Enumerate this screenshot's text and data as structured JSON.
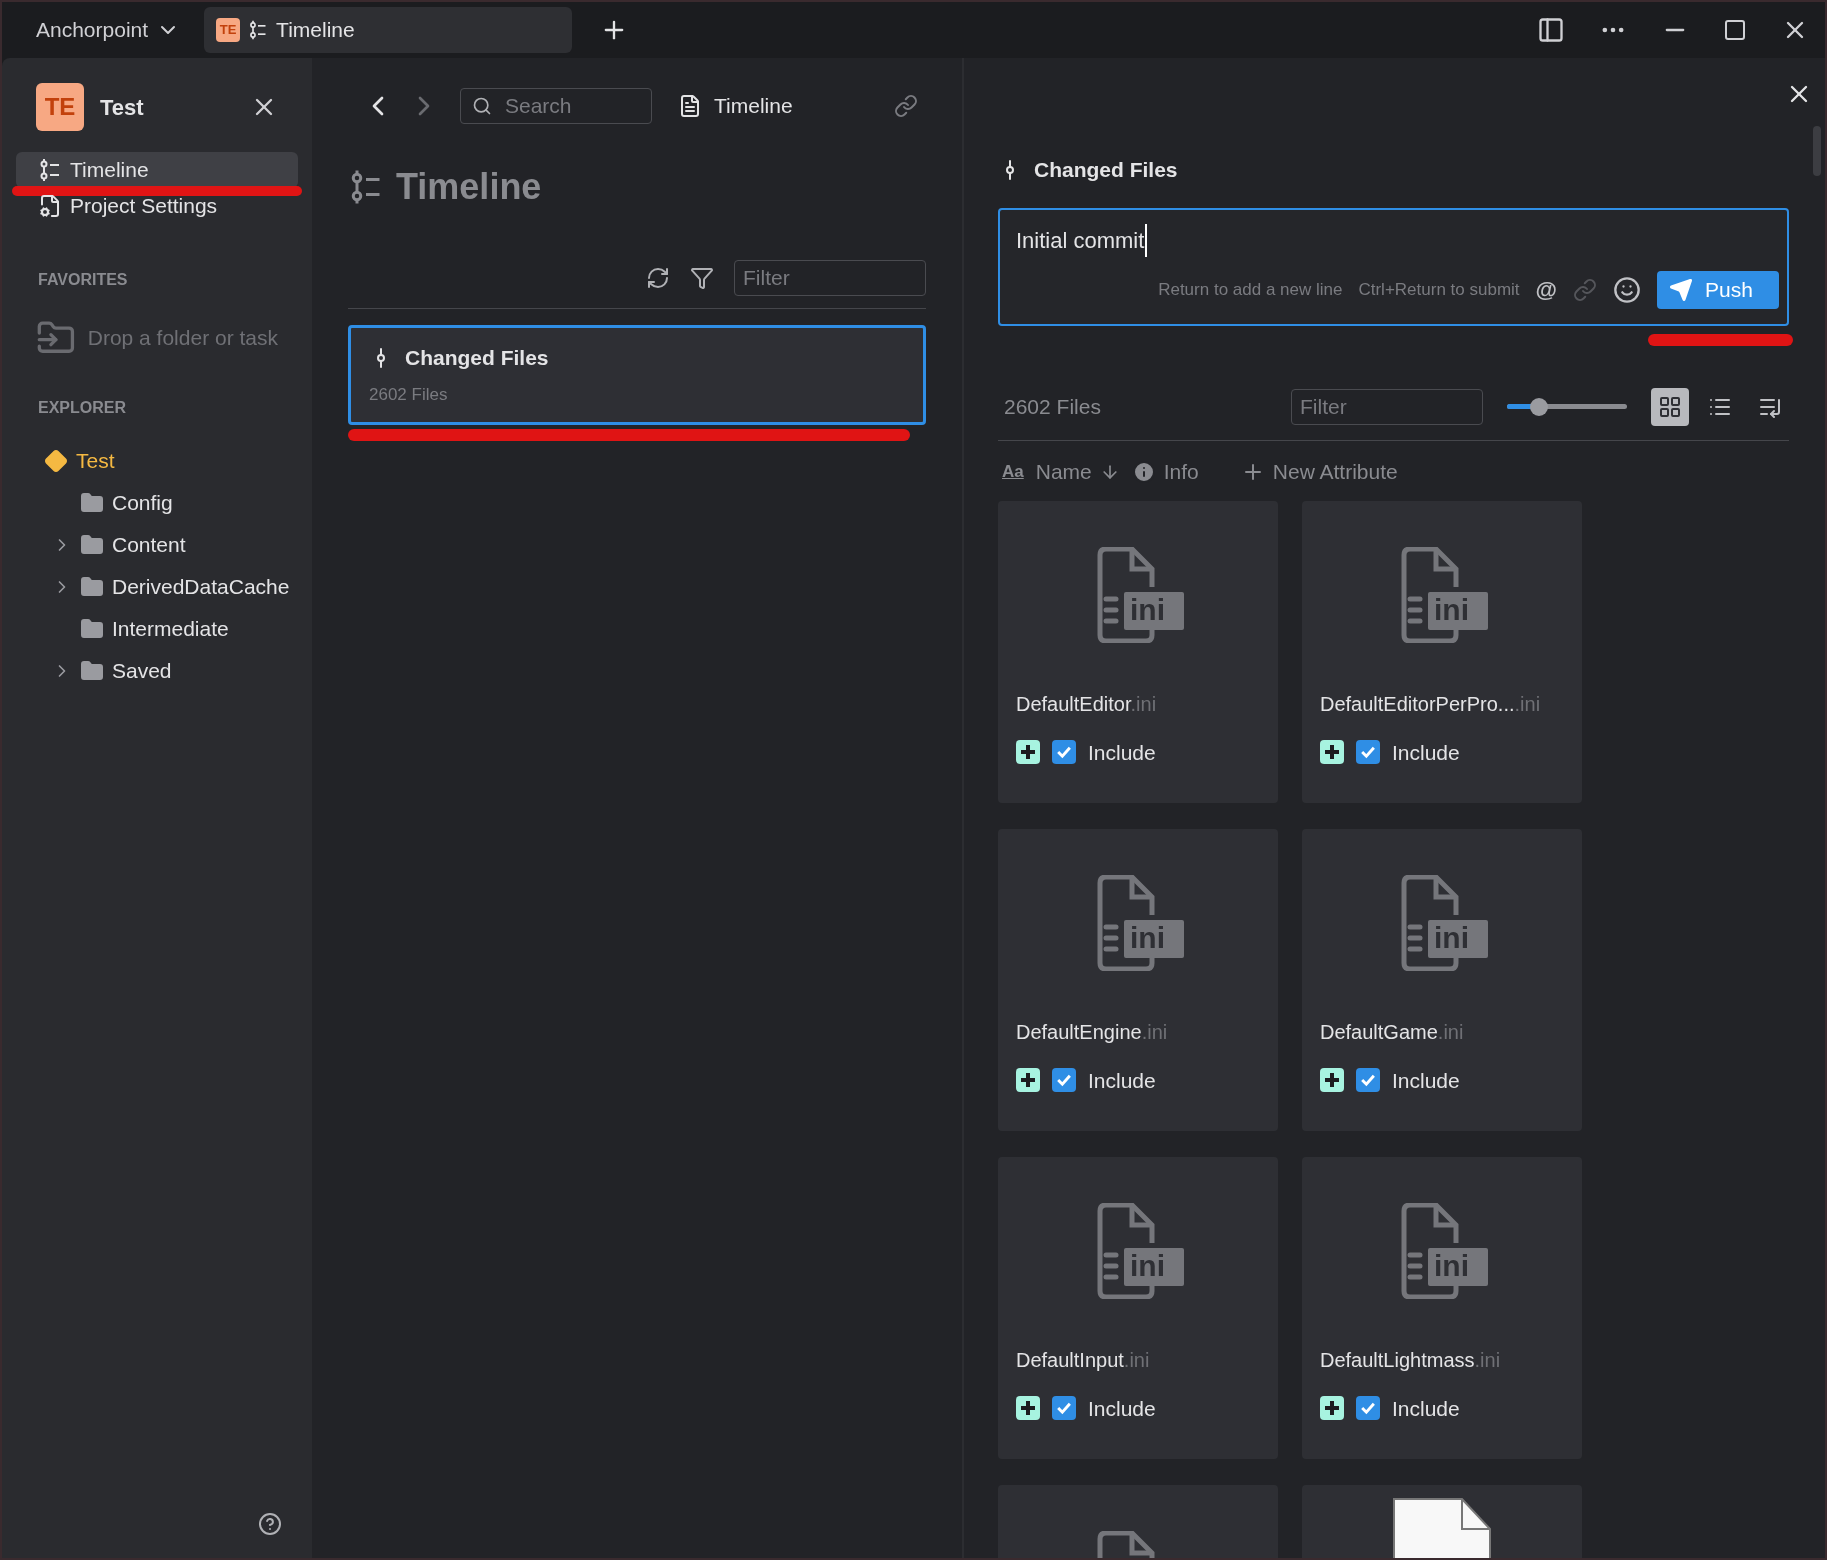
{
  "app_menu": {
    "label": "Anchorpoint"
  },
  "tabs": [
    {
      "badge": "TE",
      "label": "Timeline",
      "selected": true
    }
  ],
  "sidebar": {
    "project": {
      "badge": "TE",
      "name": "Test"
    },
    "nav": [
      {
        "label": "Timeline",
        "kind": "timeline",
        "selected": true
      },
      {
        "label": "Project Settings",
        "kind": "settings",
        "selected": false
      }
    ],
    "favorites": {
      "heading": "FAVORITES",
      "drop_hint": "Drop a folder or task"
    },
    "explorer": {
      "heading": "EXPLORER",
      "tree": [
        {
          "label": "Test",
          "kind": "project",
          "expandable": false,
          "children": [
            {
              "label": "Config",
              "kind": "folder",
              "expandable": false
            },
            {
              "label": "Content",
              "kind": "folder",
              "expandable": true
            },
            {
              "label": "DerivedDataCache",
              "kind": "folder",
              "expandable": true
            },
            {
              "label": "Intermediate",
              "kind": "folder",
              "expandable": false
            },
            {
              "label": "Saved",
              "kind": "folder",
              "expandable": true
            }
          ]
        }
      ]
    }
  },
  "middle": {
    "search_placeholder": "Search",
    "breadcrumb": "Timeline",
    "heading": "Timeline",
    "filter_placeholder": "Filter",
    "entries": [
      {
        "title": "Changed Files",
        "subtitle": "2602 Files",
        "selected": true
      }
    ]
  },
  "detail": {
    "title": "Changed Files",
    "comment": {
      "value": "Initial commit",
      "hints": [
        "Return to add a new line",
        "Ctrl+Return to submit"
      ],
      "mention": "@",
      "submit": "Push"
    },
    "files": {
      "count": "2602 Files",
      "filter_placeholder": "Filter",
      "size_slider": {
        "level": 0.27
      },
      "views": [
        {
          "kind": "grid",
          "selected": true
        },
        {
          "kind": "list",
          "selected": false
        },
        {
          "kind": "detail",
          "selected": false
        }
      ],
      "sort_label": "Aa",
      "columns": [
        {
          "kind": "name",
          "label": "Name"
        },
        {
          "kind": "info",
          "label": "Info"
        },
        {
          "kind": "add",
          "label": "New Attribute"
        }
      ],
      "items": [
        {
          "name": "DefaultEditor",
          "ext": ".ini",
          "type_label": "ini",
          "included": true,
          "label": "Include"
        },
        {
          "name": "DefaultEditorPerPro...",
          "ext": ".ini",
          "type_label": "ini",
          "included": true,
          "label": "Include"
        },
        {
          "name": "DefaultEngine",
          "ext": ".ini",
          "type_label": "ini",
          "included": true,
          "label": "Include"
        },
        {
          "name": "DefaultGame",
          "ext": ".ini",
          "type_label": "ini",
          "included": true,
          "label": "Include"
        },
        {
          "name": "DefaultInput",
          "ext": ".ini",
          "type_label": "ini",
          "included": true,
          "label": "Include"
        },
        {
          "name": "DefaultLightmass",
          "ext": ".ini",
          "type_label": "ini",
          "included": true,
          "label": "Include"
        }
      ],
      "more_cards": [
        {
          "kind": "ini"
        },
        {
          "kind": "blank"
        }
      ]
    }
  }
}
